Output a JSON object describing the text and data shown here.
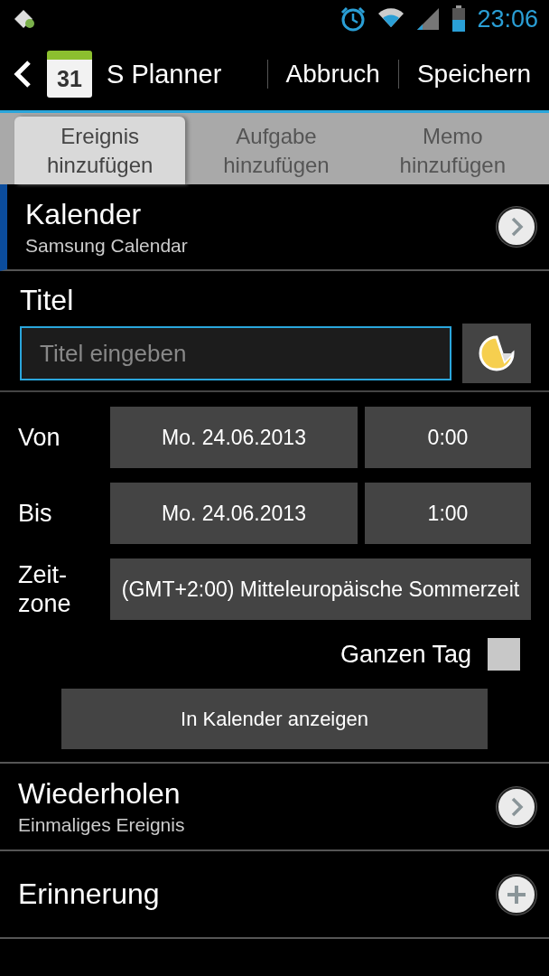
{
  "status_bar": {
    "time": "23:06"
  },
  "app_bar": {
    "calendar_day": "31",
    "title": "S Planner",
    "actions": [
      "Abbruch",
      "Speichern"
    ]
  },
  "tabs": [
    {
      "label": "Ereignis hinzufügen",
      "selected": true
    },
    {
      "label": "Aufgabe hinzufügen",
      "selected": false
    },
    {
      "label": "Memo hinzufügen",
      "selected": false
    }
  ],
  "calendar": {
    "label": "Kalender",
    "value": "Samsung Calendar"
  },
  "title_section": {
    "label": "Titel",
    "placeholder": "Titel eingeben"
  },
  "time_rows": [
    {
      "kind": "datetime",
      "label": "Von",
      "date": "Mo. 24.06.2013",
      "time": "0:00"
    },
    {
      "kind": "datetime",
      "label": "Bis",
      "date": "Mo. 24.06.2013",
      "time": "1:00"
    },
    {
      "kind": "zone",
      "label": "Zeit-\nzone",
      "value": "(GMT+2:00) Mitteleuropäische Sommerzeit"
    }
  ],
  "all_day": {
    "label": "Ganzen Tag",
    "checked": false
  },
  "show_in_calendar_button": "In Kalender anzeigen",
  "sections": [
    {
      "kind": "chevron",
      "label": "Wiederholen",
      "value": "Einmaliges Ereignis"
    },
    {
      "kind": "add",
      "label": "Erinnerung"
    }
  ]
}
